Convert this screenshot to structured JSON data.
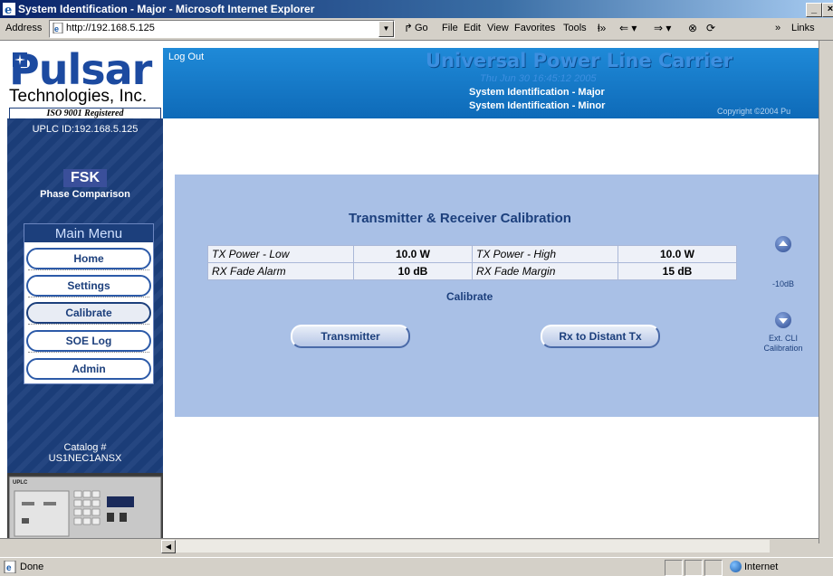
{
  "window": {
    "title": "System Identification - Major - Microsoft Internet Explorer",
    "minimize_glyph": "_",
    "close_glyph": "×"
  },
  "address_bar": {
    "label": "Address",
    "url": "http://192.168.5.125",
    "go_label": "Go",
    "menu": [
      "File",
      "Edit",
      "View",
      "Favorites",
      "Tools"
    ],
    "more_glyph": "»",
    "links_label": "Links"
  },
  "sidebar": {
    "logo_word": "Pulsar",
    "company": "Technologies, Inc.",
    "iso": "ISO 9001 Registered",
    "uplc_id": "UPLC ID:192.168.5.125",
    "fsk": "FSK",
    "phase": "Phase Comparison",
    "catalog_label": "Catalog #",
    "catalog_number": "US1NEC1ANSX",
    "device_label": "UPLC"
  },
  "main_menu": {
    "title": "Main Menu",
    "items": [
      {
        "label": "Home"
      },
      {
        "label": "Settings"
      },
      {
        "label": "Calibrate",
        "active": true
      },
      {
        "label": "SOE Log"
      },
      {
        "label": "Admin"
      }
    ]
  },
  "header": {
    "logout": "Log Out",
    "title": "Universal Power Line Carrier",
    "datetime": "Thu Jun 30 16:45:12 2005",
    "nav_major": "System Identification - Major",
    "nav_minor": "System Identification - Minor",
    "copyright": "Copyright ©2004 Pu"
  },
  "calibration": {
    "title": "Transmitter & Receiver Calibration",
    "rows": [
      {
        "label1": "TX Power - Low",
        "value1": "10.0 W",
        "label2": "TX Power - High",
        "value2": "10.0 W"
      },
      {
        "label1": "RX Fade Alarm",
        "value1": "10 dB",
        "label2": "RX Fade Margin",
        "value2": "15 dB"
      }
    ],
    "calibrate_label": "Calibrate",
    "transmitter_button": "Transmitter",
    "rx_button": "Rx to Distant Tx",
    "db_label": "-10dB",
    "ext_cli_label": "Ext. CLI",
    "ext_cli_label2": "Calibration"
  },
  "status_bar": {
    "status": "Done",
    "zone": "Internet"
  }
}
